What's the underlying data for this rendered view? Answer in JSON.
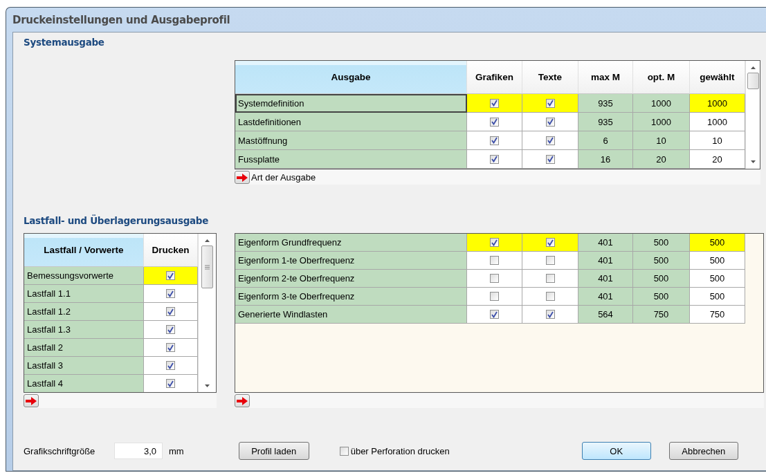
{
  "window": {
    "title": "Druckeinstellungen und Ausgabeprofil"
  },
  "system_output": {
    "heading": "Systemausgabe",
    "columns": [
      "Ausgabe",
      "Grafiken",
      "Texte",
      "max M",
      "opt. M",
      "gewählt"
    ],
    "rows": [
      {
        "name": "Systemdefinition",
        "graphics": true,
        "texts": true,
        "max_m": "935",
        "opt_m": "1000",
        "chosen": "1000",
        "selected": true
      },
      {
        "name": "Lastdefinitionen",
        "graphics": true,
        "texts": true,
        "max_m": "935",
        "opt_m": "1000",
        "chosen": "1000",
        "selected": false
      },
      {
        "name": "Mastöffnung",
        "graphics": true,
        "texts": true,
        "max_m": "6",
        "opt_m": "10",
        "chosen": "10",
        "selected": false
      },
      {
        "name": "Fussplatte",
        "graphics": true,
        "texts": true,
        "max_m": "16",
        "opt_m": "20",
        "chosen": "20",
        "selected": false
      }
    ],
    "footer_label": "Art der Ausgabe"
  },
  "load_case_output": {
    "heading": "Lastfall- und Überlagerungsausgabe",
    "cases_columns": [
      "Lastfall / Vorwerte",
      "Drucken"
    ],
    "cases": [
      {
        "name": "Bemessungsvorwerte",
        "print": true,
        "selected": true
      },
      {
        "name": "Lastfall 1.1",
        "print": true,
        "selected": false
      },
      {
        "name": "Lastfall 1.2",
        "print": true,
        "selected": false
      },
      {
        "name": "Lastfall 1.3",
        "print": true,
        "selected": false
      },
      {
        "name": "Lastfall 2",
        "print": true,
        "selected": false
      },
      {
        "name": "Lastfall 3",
        "print": true,
        "selected": false
      },
      {
        "name": "Lastfall 4",
        "print": true,
        "selected": false
      }
    ],
    "results": [
      {
        "name": "Eigenform Grundfrequenz",
        "graphics": true,
        "texts": true,
        "max_m": "401",
        "opt_m": "500",
        "chosen": "500",
        "selected": true
      },
      {
        "name": "Eigenform 1-te Oberfrequenz",
        "graphics": false,
        "texts": false,
        "max_m": "401",
        "opt_m": "500",
        "chosen": "500",
        "selected": false
      },
      {
        "name": "Eigenform 2-te Oberfrequenz",
        "graphics": false,
        "texts": false,
        "max_m": "401",
        "opt_m": "500",
        "chosen": "500",
        "selected": false
      },
      {
        "name": "Eigenform 3-te Oberfrequenz",
        "graphics": false,
        "texts": false,
        "max_m": "401",
        "opt_m": "500",
        "chosen": "500",
        "selected": false
      },
      {
        "name": "Generierte Windlasten",
        "graphics": true,
        "texts": true,
        "max_m": "564",
        "opt_m": "750",
        "chosen": "750",
        "selected": false
      }
    ]
  },
  "footer": {
    "font_size_label": "Grafikschriftgröße",
    "font_size_value": "3,0",
    "font_size_unit": "mm",
    "load_profile_button": "Profil laden",
    "perforation": {
      "label": "über Perforation drucken",
      "checked": false
    },
    "ok_button": "OK",
    "cancel_button": "Abbrechen"
  }
}
